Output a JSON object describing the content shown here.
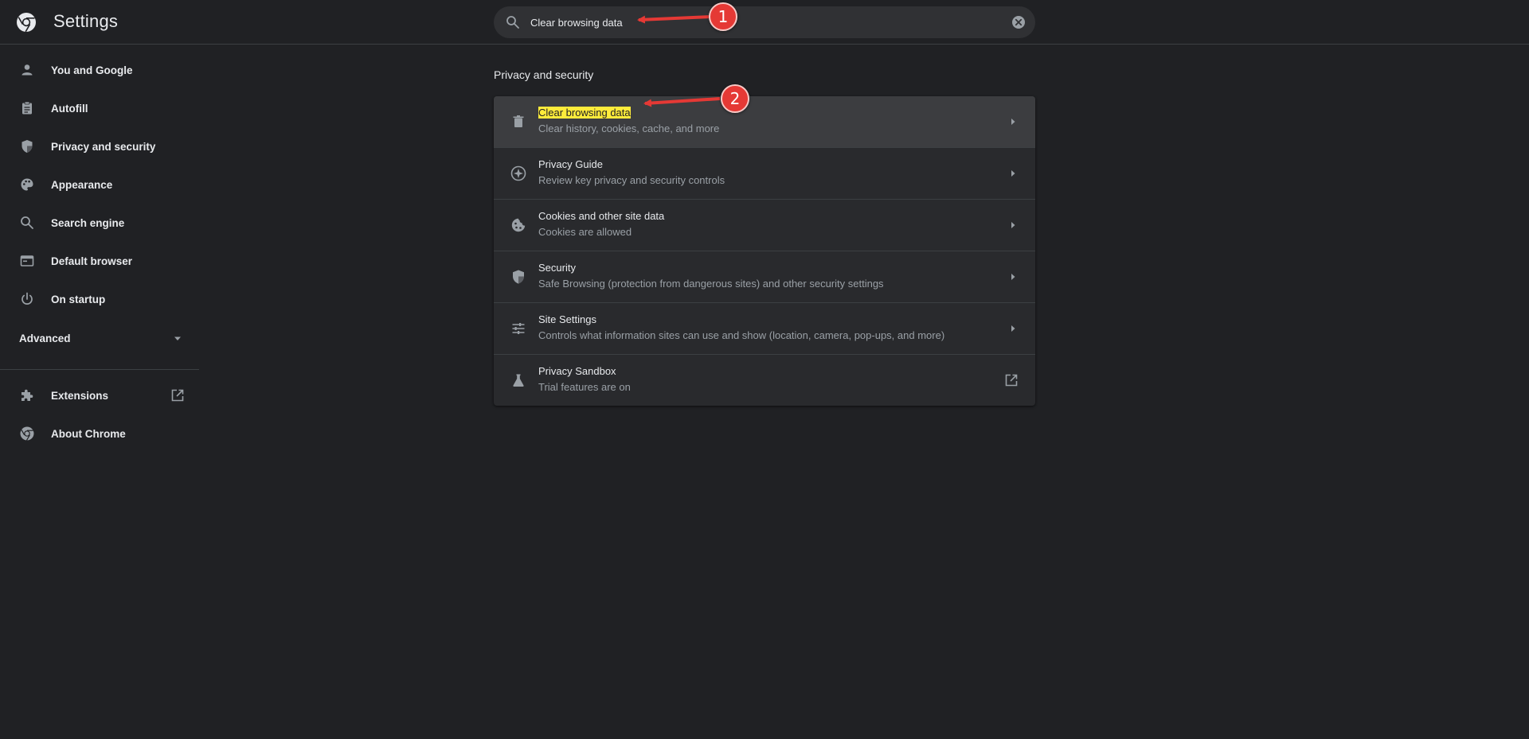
{
  "app": {
    "title": "Settings"
  },
  "search": {
    "value": "Clear browsing data"
  },
  "sidebar": {
    "items": [
      {
        "label": "You and Google",
        "icon": "person-icon"
      },
      {
        "label": "Autofill",
        "icon": "clipboard-icon"
      },
      {
        "label": "Privacy and security",
        "icon": "shield-icon"
      },
      {
        "label": "Appearance",
        "icon": "palette-icon"
      },
      {
        "label": "Search engine",
        "icon": "search-icon"
      },
      {
        "label": "Default browser",
        "icon": "browser-window-icon"
      },
      {
        "label": "On startup",
        "icon": "power-icon"
      }
    ],
    "advanced": {
      "label": "Advanced"
    },
    "bottom_items": [
      {
        "label": "Extensions",
        "icon": "puzzle-icon"
      },
      {
        "label": "About Chrome",
        "icon": "chrome-logo-icon"
      }
    ]
  },
  "main": {
    "section_title": "Privacy and security",
    "rows": [
      {
        "title": "Clear browsing data",
        "subtitle": "Clear history, cookies, cache, and more",
        "icon": "trash-icon"
      },
      {
        "title": "Privacy Guide",
        "subtitle": "Review key privacy and security controls",
        "icon": "compass-icon"
      },
      {
        "title": "Cookies and other site data",
        "subtitle": "Cookies are allowed",
        "icon": "cookie-icon"
      },
      {
        "title": "Security",
        "subtitle": "Safe Browsing (protection from dangerous sites) and other security settings",
        "icon": "shield-icon"
      },
      {
        "title": "Site Settings",
        "subtitle": "Controls what information sites can use and show (location, camera, pop-ups, and more)",
        "icon": "sliders-icon"
      },
      {
        "title": "Privacy Sandbox",
        "subtitle": "Trial features are on",
        "icon": "flask-icon"
      }
    ]
  },
  "annotations": {
    "badge_1": "1",
    "badge_2": "2"
  },
  "colors": {
    "background": "#202124",
    "highlight": "#ffeb3b",
    "annotation_red": "#e53935"
  }
}
